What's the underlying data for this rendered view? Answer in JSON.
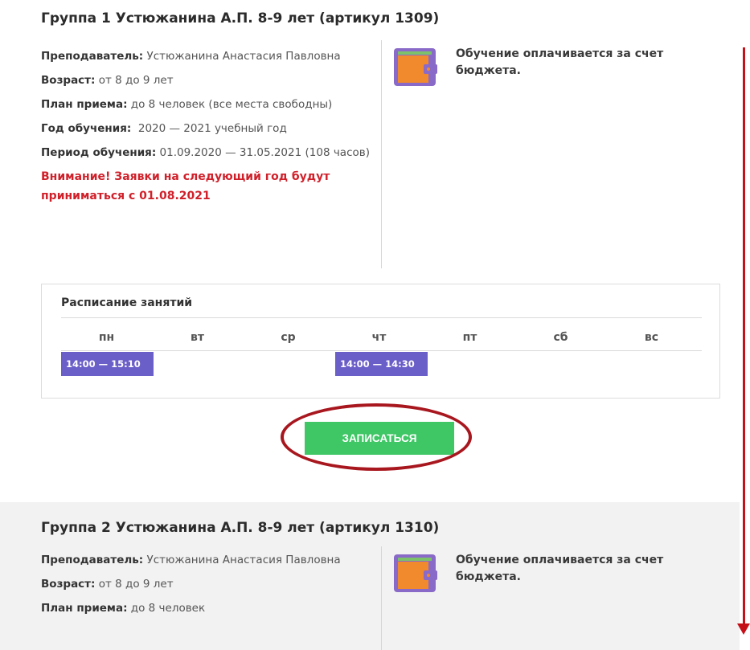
{
  "groups": [
    {
      "title": "Группа 1 Устюжанина А.П. 8-9 лет (артикул 1309)",
      "teacher_label": "Преподаватель:",
      "teacher_value": "Устюжанина Анастасия Павловна",
      "age_label": "Возраст:",
      "age_value": "от 8 до 9 лет",
      "plan_label": "План приема:",
      "plan_value": "до 8 человек (все места свободны)",
      "year_label": "Год обучения:",
      "year_value": "2020 — 2021 учебный год",
      "period_label": "Период обучения:",
      "period_value": "01.09.2020 — 31.05.2021 (108 часов)",
      "warning": "Внимание! Заявки на следующий год будут приниматься с 01.08.2021",
      "funding_text": "Обучение оплачивается за счет бюджета."
    },
    {
      "title": "Группа 2 Устюжанина А.П. 8-9 лет (артикул 1310)",
      "teacher_label": "Преподаватель:",
      "teacher_value": "Устюжанина Анастасия Павловна",
      "age_label": "Возраст:",
      "age_value": "от 8 до 9 лет",
      "plan_label": "План приема:",
      "plan_value": "до 8 человек",
      "funding_text": "Обучение оплачивается за счет бюджета."
    }
  ],
  "schedule": {
    "title": "Расписание занятий",
    "days": [
      "пн",
      "вт",
      "ср",
      "чт",
      "пт",
      "сб",
      "вс"
    ],
    "slots": [
      {
        "day": "пн",
        "time": "14:00 — 15:10"
      },
      {
        "day": "чт",
        "time": "14:00 — 14:30"
      }
    ]
  },
  "signup_button": "ЗАПИСАТЬСЯ",
  "icons": {
    "funding": "wallet-icon"
  },
  "colors": {
    "slot": "#6a5ec8",
    "button": "#3fc665",
    "warning": "#d0202a",
    "annotation": "#c61018",
    "wallet_body": "#f08a2c",
    "wallet_frame": "#8a6ac8",
    "wallet_stripe": "#7cc26a"
  }
}
